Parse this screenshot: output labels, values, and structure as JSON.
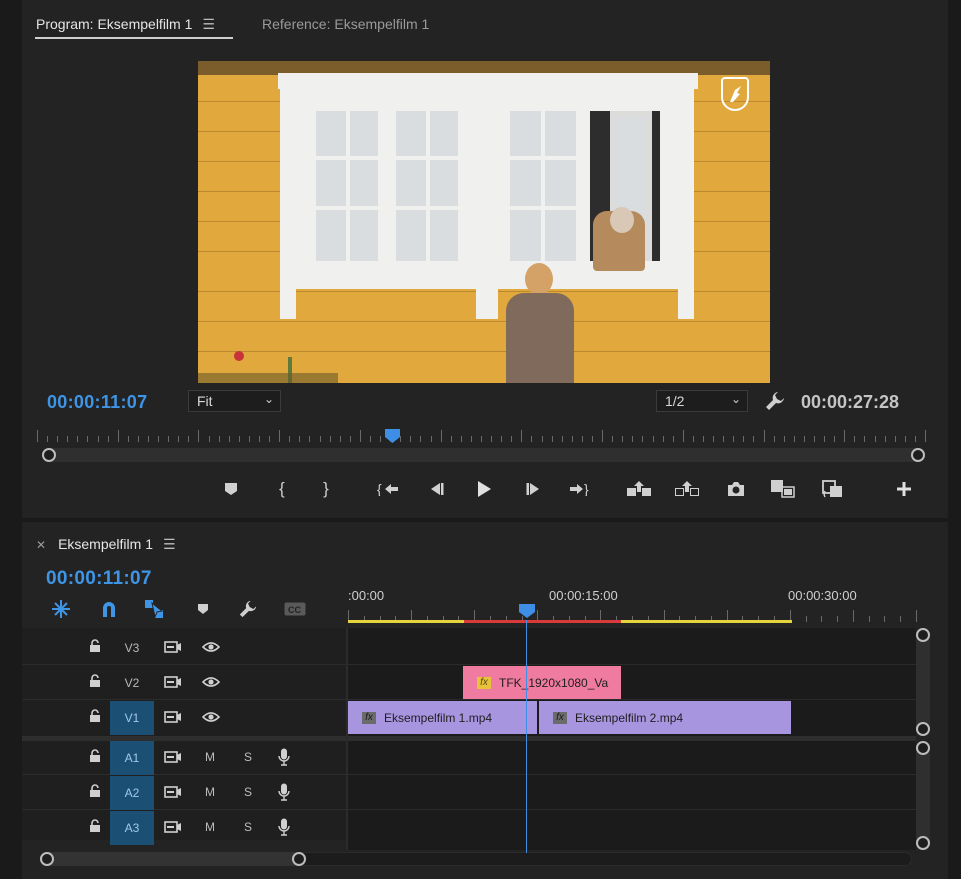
{
  "program_monitor": {
    "tabs": [
      {
        "label": "Program: Eksempelfilm 1"
      },
      {
        "label": "Reference: Eksempelfilm 1"
      }
    ],
    "current_timecode": "00:00:11:07",
    "zoom": "Fit",
    "resolution": "1/2",
    "duration": "00:00:27:28",
    "playhead_fraction": 0.4,
    "transport": [
      "add-marker",
      "mark-in",
      "mark-out",
      "go-to-in",
      "step-back",
      "play",
      "step-forward",
      "go-to-out",
      "lift",
      "extract",
      "export-frame",
      "insert",
      "overwrite",
      "button-editor"
    ]
  },
  "timeline": {
    "sequence_name": "Eksempelfilm 1",
    "timecode": "00:00:11:07",
    "ruler_labels": [
      ":00:00",
      "00:00:15:00",
      "00:00:30:00"
    ],
    "video_tracks": [
      {
        "name": "V3",
        "active": false
      },
      {
        "name": "V2",
        "active": false
      },
      {
        "name": "V1",
        "active": true
      }
    ],
    "audio_tracks": [
      {
        "name": "A1",
        "mute": "M",
        "solo": "S"
      },
      {
        "name": "A2",
        "mute": "M",
        "solo": "S"
      },
      {
        "name": "A3",
        "mute": "M",
        "solo": "S"
      }
    ],
    "clips": [
      {
        "name": "TFK_1920x1080_Va",
        "track": "V2",
        "fx": "fx"
      },
      {
        "name": "Eksempelfilm 1.mp4",
        "track": "V1",
        "fx": "fx"
      },
      {
        "name": "Eksempelfilm 2.mp4",
        "track": "V1",
        "fx": "fx"
      }
    ]
  },
  "colors": {
    "accent_blue": "#3e95e6",
    "clip_video": "#a895e0",
    "clip_graphic": "#f07ba0",
    "work_area_yellow": "#e2d43a",
    "render_red": "#d93b3b"
  }
}
